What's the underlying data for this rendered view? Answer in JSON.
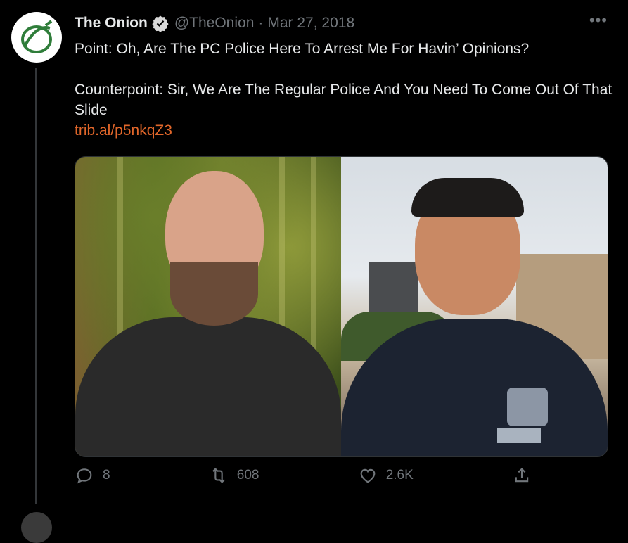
{
  "tweet": {
    "author_name": "The Onion",
    "handle": "@TheOnion",
    "separator": "·",
    "date": "Mar 27, 2018",
    "text": "Point: Oh, Are The PC Police Here To Arrest Me For Havin’ Opinions?\n\nCounterpoint: Sir, We Are The Regular Police And You Need To Come Out Of That Slide",
    "link": "trib.al/p5nkqZ3",
    "more_label": "•••"
  },
  "icons": {
    "avatar": "onion-logo-icon",
    "verified": "verified-badge-icon",
    "reply": "reply-icon",
    "retweet": "retweet-icon",
    "like": "like-icon",
    "share": "share-icon"
  },
  "metrics": {
    "replies": "8",
    "retweets": "608",
    "likes": "2.6K"
  },
  "colors": {
    "background": "#000000",
    "text": "#e7e9ea",
    "secondary": "#71767b",
    "link": "#e0662a",
    "onion_green": "#2f7d3a"
  }
}
